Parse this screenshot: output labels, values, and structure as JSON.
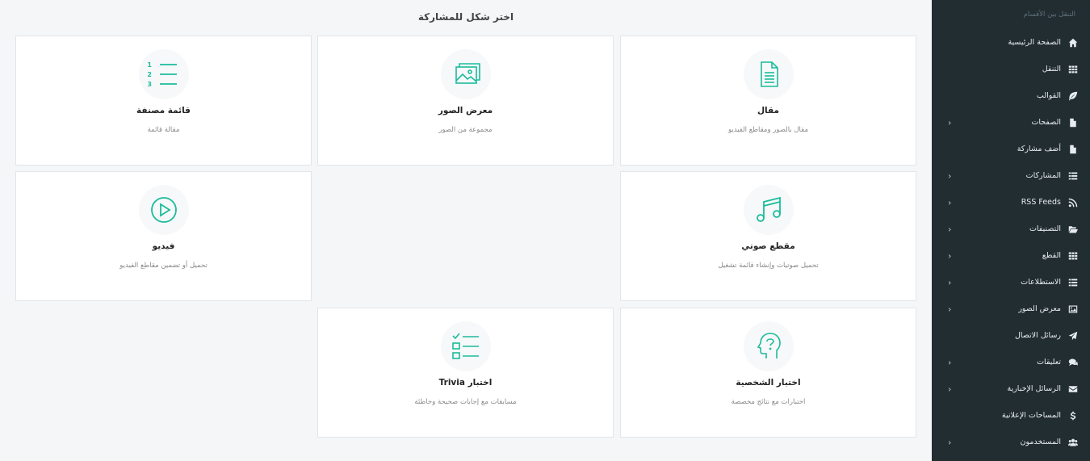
{
  "sidebar": {
    "header": "التنقل بين الأقسام",
    "items": [
      {
        "label": "الصفحة الرئيسية",
        "icon": "home-icon",
        "has_submenu": false
      },
      {
        "label": "التنقل",
        "icon": "grid-icon",
        "has_submenu": false
      },
      {
        "label": "القوالب",
        "icon": "leaf-icon",
        "has_submenu": false
      },
      {
        "label": "الصفحات",
        "icon": "file-icon",
        "has_submenu": true
      },
      {
        "label": "أضف مشاركة",
        "icon": "file-icon",
        "has_submenu": false
      },
      {
        "label": "المشاركات",
        "icon": "list-icon",
        "has_submenu": true
      },
      {
        "label": "RSS Feeds",
        "icon": "rss-icon",
        "has_submenu": true
      },
      {
        "label": "التصنيفات",
        "icon": "folder-open-icon",
        "has_submenu": true
      },
      {
        "label": "القطع",
        "icon": "grid-icon",
        "has_submenu": true
      },
      {
        "label": "الاستطلاعات",
        "icon": "list-icon",
        "has_submenu": true
      },
      {
        "label": "معرض الصور",
        "icon": "image-icon",
        "has_submenu": true
      },
      {
        "label": "رسائل الاتصال",
        "icon": "paper-plane-icon",
        "has_submenu": false
      },
      {
        "label": "تعليقات",
        "icon": "comments-icon",
        "has_submenu": true
      },
      {
        "label": "الرسائل الإخبارية",
        "icon": "envelope-icon",
        "has_submenu": true
      },
      {
        "label": "المساحات الإعلانية",
        "icon": "dollar-icon",
        "has_submenu": false
      },
      {
        "label": "المستخدمون",
        "icon": "users-icon",
        "has_submenu": true
      }
    ],
    "chevron": "‹"
  },
  "main": {
    "title": "اختر شكل للمشاركة",
    "accent_color": "#1abc9c",
    "cards": [
      {
        "key": "article",
        "title": "مقال",
        "desc": "مقال بالصور ومقاطع الفيديو",
        "icon": "document-icon"
      },
      {
        "key": "gallery",
        "title": "معرض الصور",
        "desc": "مجموعة من الصور",
        "icon": "gallery-icon"
      },
      {
        "key": "sorted-list",
        "title": "قائمة مصنفة",
        "desc": "مقالة قائمة",
        "icon": "numbered-list-icon"
      },
      {
        "key": "audio",
        "title": "مقطع صوتي",
        "desc": "تحميل صوتيات وإنشاء قائمة تشغيل",
        "icon": "music-icon"
      },
      {
        "key": "video",
        "title": "فيديو",
        "desc": "تحميل أو تضمين مقاطع الفيديو",
        "icon": "play-icon"
      },
      {
        "key": "personality-quiz",
        "title": "اختبار الشخصية",
        "desc": "اختبارات مع نتائج مخصصة",
        "icon": "head-question-icon"
      },
      {
        "key": "trivia-quiz",
        "title": "اختبار Trivia",
        "desc": "مسابقات مع إجابات صحيحة وخاطئة",
        "icon": "checklist-icon"
      }
    ]
  }
}
